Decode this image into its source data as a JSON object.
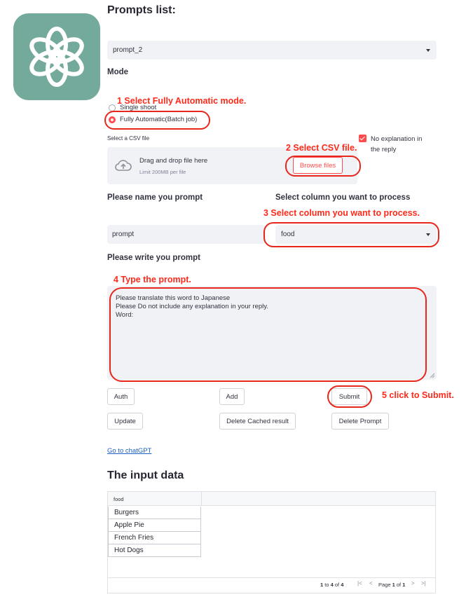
{
  "prompts_list": {
    "title": "Prompts list:",
    "selected": "prompt_2"
  },
  "mode": {
    "label": "Mode",
    "options": [
      "Single shoot",
      "Fully Automatic(Batch job)"
    ],
    "selected_index": 1
  },
  "csv": {
    "label": "Select a CSV file",
    "drag_text": "Drag and drop file here",
    "limit_text": "Limit 200MB per file",
    "browse_label": "Browse files"
  },
  "no_explanation": {
    "line1": "No explanation in",
    "line2": "the reply",
    "checked": true
  },
  "prompt_name": {
    "label": "Please name you prompt",
    "value": "prompt"
  },
  "column": {
    "label": "Select column you want to process",
    "selected": "food"
  },
  "prompt_text": {
    "label": "Please write you prompt",
    "value": "Please translate this word to Japanese\nPlease  Do not include any explanation in your reply.\nWord:"
  },
  "buttons": {
    "auth": "Auth",
    "add": "Add",
    "submit": "Submit",
    "update": "Update",
    "delete_cached": "Delete Cached result",
    "delete_prompt": "Delete Prompt"
  },
  "link": "Go to chatGPT",
  "input_data": {
    "title": "The input data",
    "column_header": "food",
    "rows": [
      "Burgers",
      "Apple Pie",
      "French Fries",
      "Hot Dogs"
    ],
    "pager": {
      "from": "1",
      "to_word": "to",
      "to": "4",
      "of_word": "of",
      "total": "4",
      "page_word": "Page",
      "page": "1",
      "page_of": "of",
      "pages": "1"
    }
  },
  "annotations": {
    "step1": "1 Select Fully Automatic mode.",
    "step2": "2 Select CSV file.",
    "step3": "3 Select column you want to process.",
    "step4": "4 Type the prompt.",
    "step5": "5 click to Submit."
  },
  "colors": {
    "accent": "#ff4b4b",
    "annotation": "#e8271c",
    "logo_bg": "#74aa9c",
    "field_bg": "#f0f2f6",
    "link": "#1a5fbf"
  }
}
